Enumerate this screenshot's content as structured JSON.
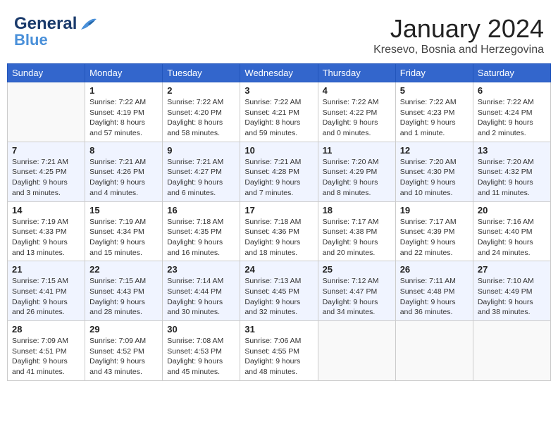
{
  "logo": {
    "line1": "General",
    "line2": "Blue"
  },
  "title": "January 2024",
  "location": "Kresevo, Bosnia and Herzegovina",
  "days": [
    "Sunday",
    "Monday",
    "Tuesday",
    "Wednesday",
    "Thursday",
    "Friday",
    "Saturday"
  ],
  "weeks": [
    [
      {
        "date": "",
        "info": ""
      },
      {
        "date": "1",
        "info": "Sunrise: 7:22 AM\nSunset: 4:19 PM\nDaylight: 8 hours\nand 57 minutes."
      },
      {
        "date": "2",
        "info": "Sunrise: 7:22 AM\nSunset: 4:20 PM\nDaylight: 8 hours\nand 58 minutes."
      },
      {
        "date": "3",
        "info": "Sunrise: 7:22 AM\nSunset: 4:21 PM\nDaylight: 8 hours\nand 59 minutes."
      },
      {
        "date": "4",
        "info": "Sunrise: 7:22 AM\nSunset: 4:22 PM\nDaylight: 9 hours\nand 0 minutes."
      },
      {
        "date": "5",
        "info": "Sunrise: 7:22 AM\nSunset: 4:23 PM\nDaylight: 9 hours\nand 1 minute."
      },
      {
        "date": "6",
        "info": "Sunrise: 7:22 AM\nSunset: 4:24 PM\nDaylight: 9 hours\nand 2 minutes."
      }
    ],
    [
      {
        "date": "7",
        "info": "Sunrise: 7:21 AM\nSunset: 4:25 PM\nDaylight: 9 hours\nand 3 minutes."
      },
      {
        "date": "8",
        "info": "Sunrise: 7:21 AM\nSunset: 4:26 PM\nDaylight: 9 hours\nand 4 minutes."
      },
      {
        "date": "9",
        "info": "Sunrise: 7:21 AM\nSunset: 4:27 PM\nDaylight: 9 hours\nand 6 minutes."
      },
      {
        "date": "10",
        "info": "Sunrise: 7:21 AM\nSunset: 4:28 PM\nDaylight: 9 hours\nand 7 minutes."
      },
      {
        "date": "11",
        "info": "Sunrise: 7:20 AM\nSunset: 4:29 PM\nDaylight: 9 hours\nand 8 minutes."
      },
      {
        "date": "12",
        "info": "Sunrise: 7:20 AM\nSunset: 4:30 PM\nDaylight: 9 hours\nand 10 minutes."
      },
      {
        "date": "13",
        "info": "Sunrise: 7:20 AM\nSunset: 4:32 PM\nDaylight: 9 hours\nand 11 minutes."
      }
    ],
    [
      {
        "date": "14",
        "info": "Sunrise: 7:19 AM\nSunset: 4:33 PM\nDaylight: 9 hours\nand 13 minutes."
      },
      {
        "date": "15",
        "info": "Sunrise: 7:19 AM\nSunset: 4:34 PM\nDaylight: 9 hours\nand 15 minutes."
      },
      {
        "date": "16",
        "info": "Sunrise: 7:18 AM\nSunset: 4:35 PM\nDaylight: 9 hours\nand 16 minutes."
      },
      {
        "date": "17",
        "info": "Sunrise: 7:18 AM\nSunset: 4:36 PM\nDaylight: 9 hours\nand 18 minutes."
      },
      {
        "date": "18",
        "info": "Sunrise: 7:17 AM\nSunset: 4:38 PM\nDaylight: 9 hours\nand 20 minutes."
      },
      {
        "date": "19",
        "info": "Sunrise: 7:17 AM\nSunset: 4:39 PM\nDaylight: 9 hours\nand 22 minutes."
      },
      {
        "date": "20",
        "info": "Sunrise: 7:16 AM\nSunset: 4:40 PM\nDaylight: 9 hours\nand 24 minutes."
      }
    ],
    [
      {
        "date": "21",
        "info": "Sunrise: 7:15 AM\nSunset: 4:41 PM\nDaylight: 9 hours\nand 26 minutes."
      },
      {
        "date": "22",
        "info": "Sunrise: 7:15 AM\nSunset: 4:43 PM\nDaylight: 9 hours\nand 28 minutes."
      },
      {
        "date": "23",
        "info": "Sunrise: 7:14 AM\nSunset: 4:44 PM\nDaylight: 9 hours\nand 30 minutes."
      },
      {
        "date": "24",
        "info": "Sunrise: 7:13 AM\nSunset: 4:45 PM\nDaylight: 9 hours\nand 32 minutes."
      },
      {
        "date": "25",
        "info": "Sunrise: 7:12 AM\nSunset: 4:47 PM\nDaylight: 9 hours\nand 34 minutes."
      },
      {
        "date": "26",
        "info": "Sunrise: 7:11 AM\nSunset: 4:48 PM\nDaylight: 9 hours\nand 36 minutes."
      },
      {
        "date": "27",
        "info": "Sunrise: 7:10 AM\nSunset: 4:49 PM\nDaylight: 9 hours\nand 38 minutes."
      }
    ],
    [
      {
        "date": "28",
        "info": "Sunrise: 7:09 AM\nSunset: 4:51 PM\nDaylight: 9 hours\nand 41 minutes."
      },
      {
        "date": "29",
        "info": "Sunrise: 7:09 AM\nSunset: 4:52 PM\nDaylight: 9 hours\nand 43 minutes."
      },
      {
        "date": "30",
        "info": "Sunrise: 7:08 AM\nSunset: 4:53 PM\nDaylight: 9 hours\nand 45 minutes."
      },
      {
        "date": "31",
        "info": "Sunrise: 7:06 AM\nSunset: 4:55 PM\nDaylight: 9 hours\nand 48 minutes."
      },
      {
        "date": "",
        "info": ""
      },
      {
        "date": "",
        "info": ""
      },
      {
        "date": "",
        "info": ""
      }
    ]
  ]
}
